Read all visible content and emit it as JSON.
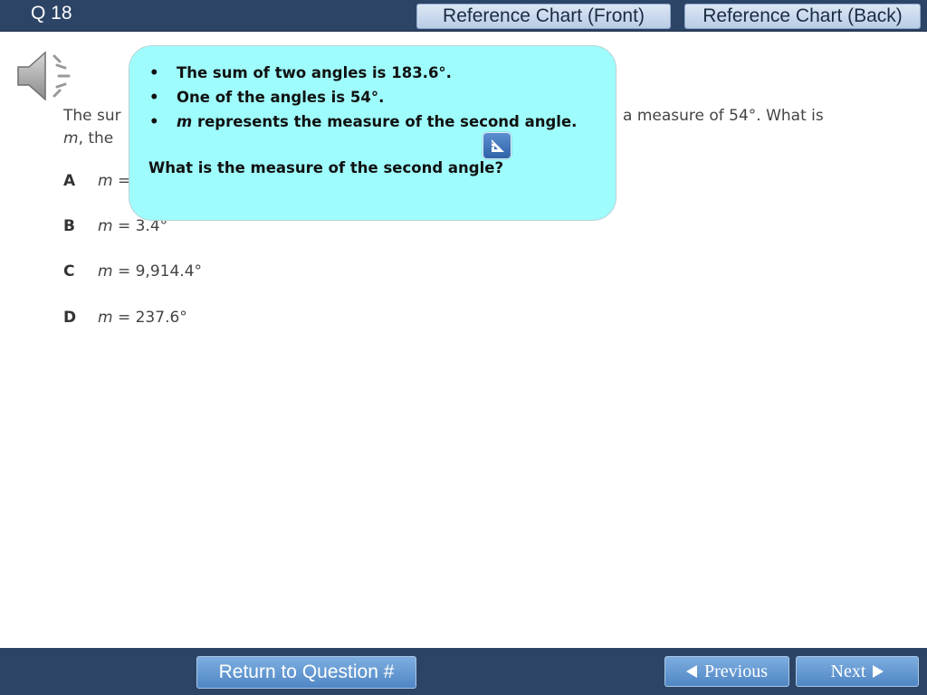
{
  "header": {
    "question_number": "Q 18",
    "reference_front_label": "Reference Chart (Front)",
    "reference_back_label": "Reference Chart (Back)"
  },
  "question": {
    "stem_line1_left": "The sur",
    "stem_line1_right": "a measure of 54°. What is",
    "stem_line2_var": "m",
    "stem_line2_text": ", the",
    "choices": [
      {
        "letter": "A",
        "var": "m",
        "text": "="
      },
      {
        "letter": "B",
        "var": "m",
        "text": "= 3.4°"
      },
      {
        "letter": "C",
        "var": "m",
        "text": "= 9,914.4°"
      },
      {
        "letter": "D",
        "var": "m",
        "text": "= 237.6°"
      }
    ]
  },
  "callout": {
    "bullets": [
      {
        "text": "The sum of two angles is 183.6°."
      },
      {
        "text": "One of the angles is 54°."
      },
      {
        "var": "m",
        "text": " represents the measure of the second angle."
      }
    ],
    "question": "What is the measure of the second angle?"
  },
  "icons": {
    "speaker": "speaker-icon",
    "tool": "triangle-ruler-icon"
  },
  "footer": {
    "return_label": "Return to Question #",
    "previous_label": "Previous",
    "next_label": "Next"
  },
  "colors": {
    "bar": "#2c4566",
    "callout": "#9ffcfd",
    "button": "#5f93cd"
  }
}
